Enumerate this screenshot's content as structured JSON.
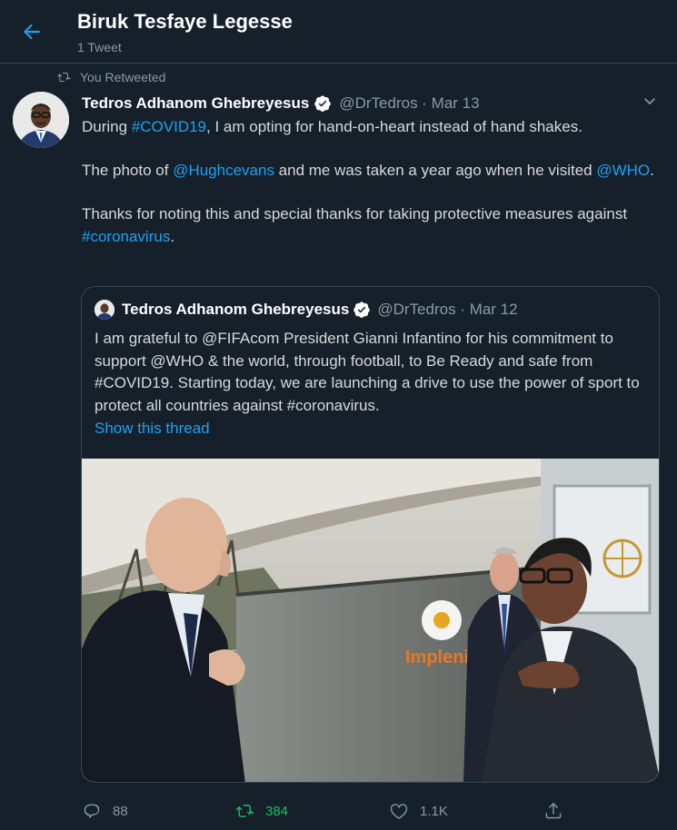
{
  "header": {
    "title": "Biruk Tesfaye Legesse",
    "subtitle": "1 Tweet"
  },
  "retweet": {
    "label": "You Retweeted"
  },
  "tweet": {
    "author_name": "Tedros Adhanom Ghebreyesus",
    "handle_date": "@DrTedros · Mar 13",
    "p1": {
      "a": "During ",
      "hashtag": "#COVID19",
      "b": ", I am opting for hand-on-heart instead of hand shakes."
    },
    "p2": {
      "a": "The photo of ",
      "mention1": "@Hughcevans",
      "b": " and me was taken a year ago when he visited ",
      "mention2": "@WHO",
      "c": "."
    },
    "p3": {
      "a": "Thanks for noting this and special thanks for taking protective measures against ",
      "hashtag": "#coronavirus",
      "b": "."
    }
  },
  "quote": {
    "author_name": "Tedros Adhanom Ghebreyesus",
    "handle_date": "@DrTedros · Mar 12",
    "text": "I am grateful to @FIFAcom President Gianni Infantino for his commitment to support @WHO & the world, through football, to Be Ready and safe from #COVID19. Starting today, we are launching a drive to use the power of sport to protect all countries against #coronavirus.",
    "show_thread": "Show this thread",
    "photo_sign_text": "Implenia"
  },
  "actions": {
    "replies": "88",
    "retweets": "384",
    "likes": "1.1K"
  },
  "colors": {
    "background": "#15202b",
    "accent": "#1da1f2",
    "retweet_green": "#17bf63",
    "muted": "#8899a6"
  }
}
